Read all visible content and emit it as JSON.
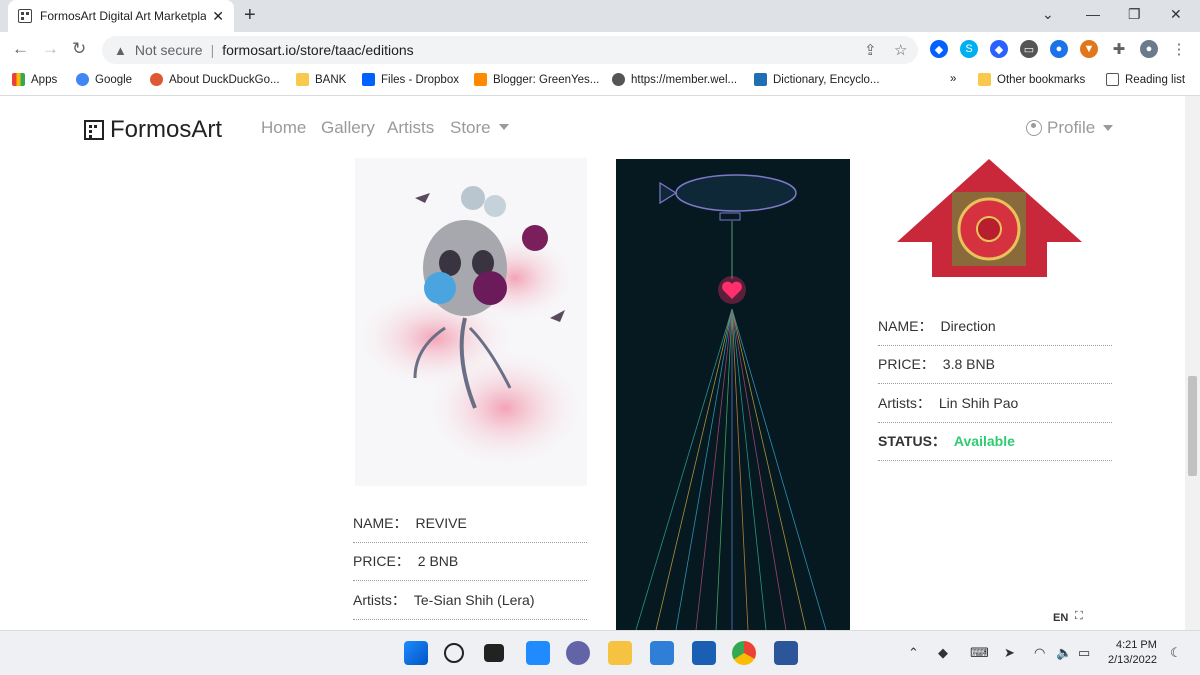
{
  "browser": {
    "tab_title": "FormosArt Digital Art Marketplac",
    "new_tab": "+",
    "security": "Not secure",
    "url": "formosart.io/store/taac/editions",
    "bookmarks": [
      "Apps",
      "Google",
      "About DuckDuckGo...",
      "BANK",
      "Files - Dropbox",
      "Blogger: GreenYes...",
      "https://member.wel...",
      "Dictionary, Encyclo..."
    ],
    "bookmarks_more": "»",
    "other_bookmarks": "Other bookmarks",
    "reading_list": "Reading list"
  },
  "site": {
    "logo": "FormosArt",
    "nav": {
      "home": "Home",
      "gallery": "Gallery",
      "artists": "Artists",
      "store": "Store"
    },
    "profile": "Profile",
    "lang": "EN"
  },
  "artworks": [
    {
      "name_label": "NAME：",
      "name": "REVIVE",
      "price_label": "PRICE：",
      "price": "2 BNB",
      "artist_label": "Artists：",
      "artist": "Te-Sian Shih (Lera)"
    },
    {
      "name_label": "NAME：",
      "name": "Direction",
      "price_label": "PRICE：",
      "price": "3.8 BNB",
      "artist_label": "Artists：",
      "artist": "Lin Shih Pao",
      "status_label": "STATUS：",
      "status": "Available"
    }
  ],
  "taskbar": {
    "time": "4:21 PM",
    "date": "2/13/2022"
  },
  "colors": {
    "available": "#2ecc71",
    "accent": "#1a73e8"
  }
}
